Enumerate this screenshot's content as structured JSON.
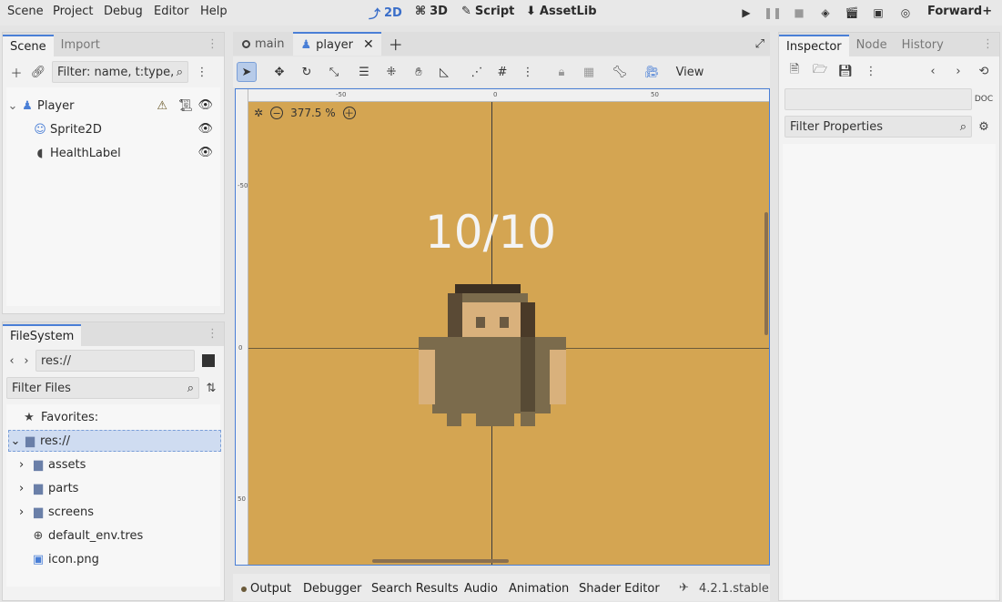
{
  "menubar": {
    "items": [
      "Scene",
      "Project",
      "Debug",
      "Editor",
      "Help"
    ],
    "workspaces": [
      "2D",
      "3D",
      "Script",
      "AssetLib"
    ],
    "active_workspace": "2D",
    "renderer": "Forward+"
  },
  "scene_dock": {
    "tabs": [
      "Scene",
      "Import"
    ],
    "filter_placeholder": "Filter: name, t:type,",
    "nodes": [
      {
        "label": "Player",
        "icon": "character-body-icon"
      },
      {
        "label": "Sprite2D",
        "icon": "sprite-icon"
      },
      {
        "label": "HealthLabel",
        "icon": "label-icon"
      }
    ]
  },
  "filesystem_dock": {
    "tab": "FileSystem",
    "path": "res://",
    "filter_placeholder": "Filter Files",
    "favorites_label": "Favorites:",
    "root_label": "res://",
    "items": [
      {
        "label": "assets",
        "type": "folder"
      },
      {
        "label": "parts",
        "type": "folder"
      },
      {
        "label": "screens",
        "type": "folder"
      },
      {
        "label": "default_env.tres",
        "type": "resource"
      },
      {
        "label": "icon.png",
        "type": "image"
      }
    ]
  },
  "editor_tabs": [
    {
      "label": "main"
    },
    {
      "label": "player"
    }
  ],
  "toolbar": {
    "view_label": "View"
  },
  "viewport": {
    "zoom": "377.5 %",
    "health_text": "10/10",
    "ruler_top": [
      "-50",
      "0",
      "50"
    ],
    "ruler_left": [
      "-50",
      "0",
      "50"
    ],
    "background_color": "#d4a552"
  },
  "inspector_dock": {
    "tabs": [
      "Inspector",
      "Node",
      "History"
    ],
    "filter_placeholder": "Filter Properties"
  },
  "bottom_panel": {
    "tabs": [
      "Output",
      "Debugger",
      "Search Results",
      "Audio",
      "Animation",
      "Shader Editor"
    ],
    "version": "4.2.1.stable"
  }
}
